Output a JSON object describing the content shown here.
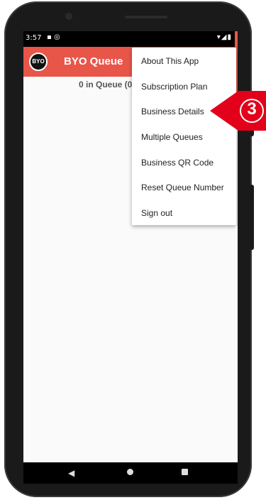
{
  "status_bar": {
    "time": "3:57",
    "left_icons": "▪ ◎",
    "right_icons": "▾◢▮"
  },
  "app_bar": {
    "logo_text": "BYO",
    "title": "BYO Queue",
    "color": "#e8564a"
  },
  "main": {
    "queue_count": "0 in Queue (0"
  },
  "menu": {
    "items": [
      {
        "label": "About This App"
      },
      {
        "label": "Subscription Plan"
      },
      {
        "label": "Business Details"
      },
      {
        "label": "Multiple Queues"
      },
      {
        "label": "Business QR Code"
      },
      {
        "label": "Reset Queue Number"
      },
      {
        "label": "Sign out"
      }
    ]
  },
  "callout": {
    "number": "3",
    "color": "#e3001b"
  },
  "nav_bar": {
    "back_icon": "back-triangle-icon",
    "home_icon": "home-circle-icon",
    "recents_icon": "recents-square-icon"
  }
}
